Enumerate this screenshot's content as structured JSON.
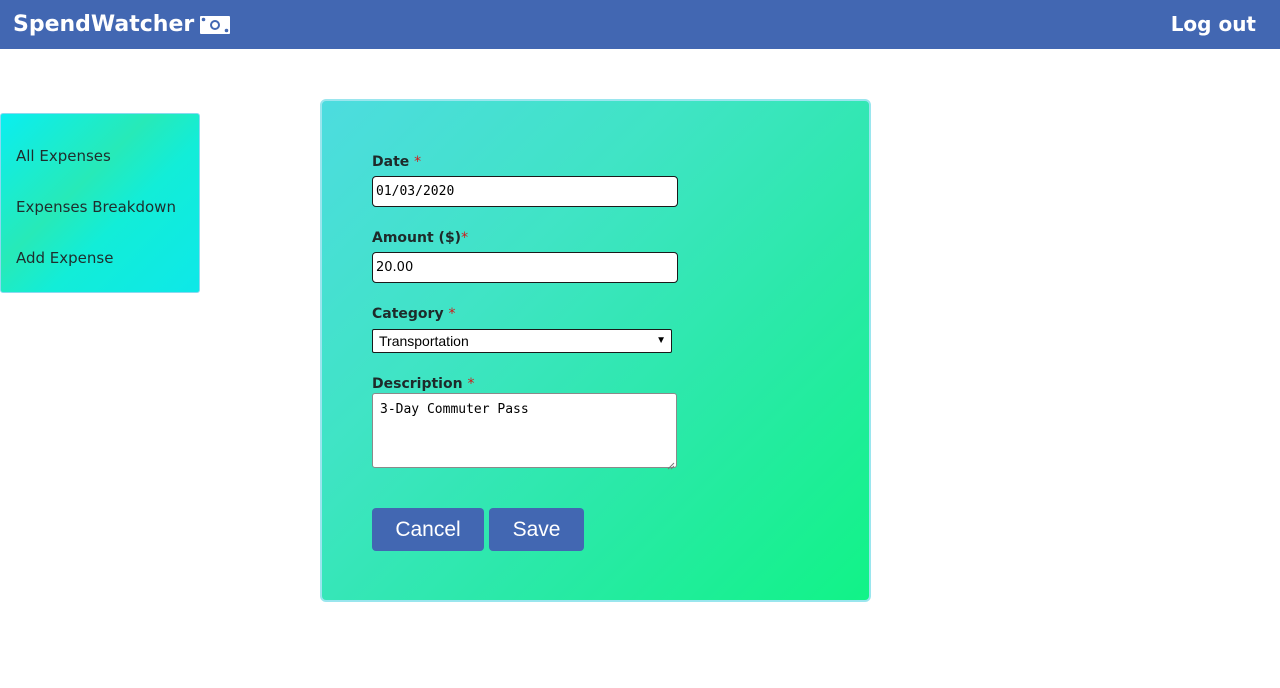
{
  "header": {
    "brand": "SpendWatcher",
    "brand_icon": "money-bill-icon",
    "logout_label": "Log out",
    "background_color": "#4267b2"
  },
  "sidebar": {
    "items": [
      {
        "label": "All Expenses"
      },
      {
        "label": "Expenses Breakdown"
      },
      {
        "label": "Add Expense"
      }
    ]
  },
  "form": {
    "required_mark": "*",
    "date": {
      "label": "Date",
      "value": "01/03/2020"
    },
    "amount": {
      "label": "Amount ($)",
      "value": "20.00"
    },
    "category": {
      "label": "Category",
      "value": "Transportation"
    },
    "description": {
      "label": "Description",
      "value": "3-Day Commuter Pass"
    },
    "cancel_label": "Cancel",
    "save_label": "Save"
  }
}
